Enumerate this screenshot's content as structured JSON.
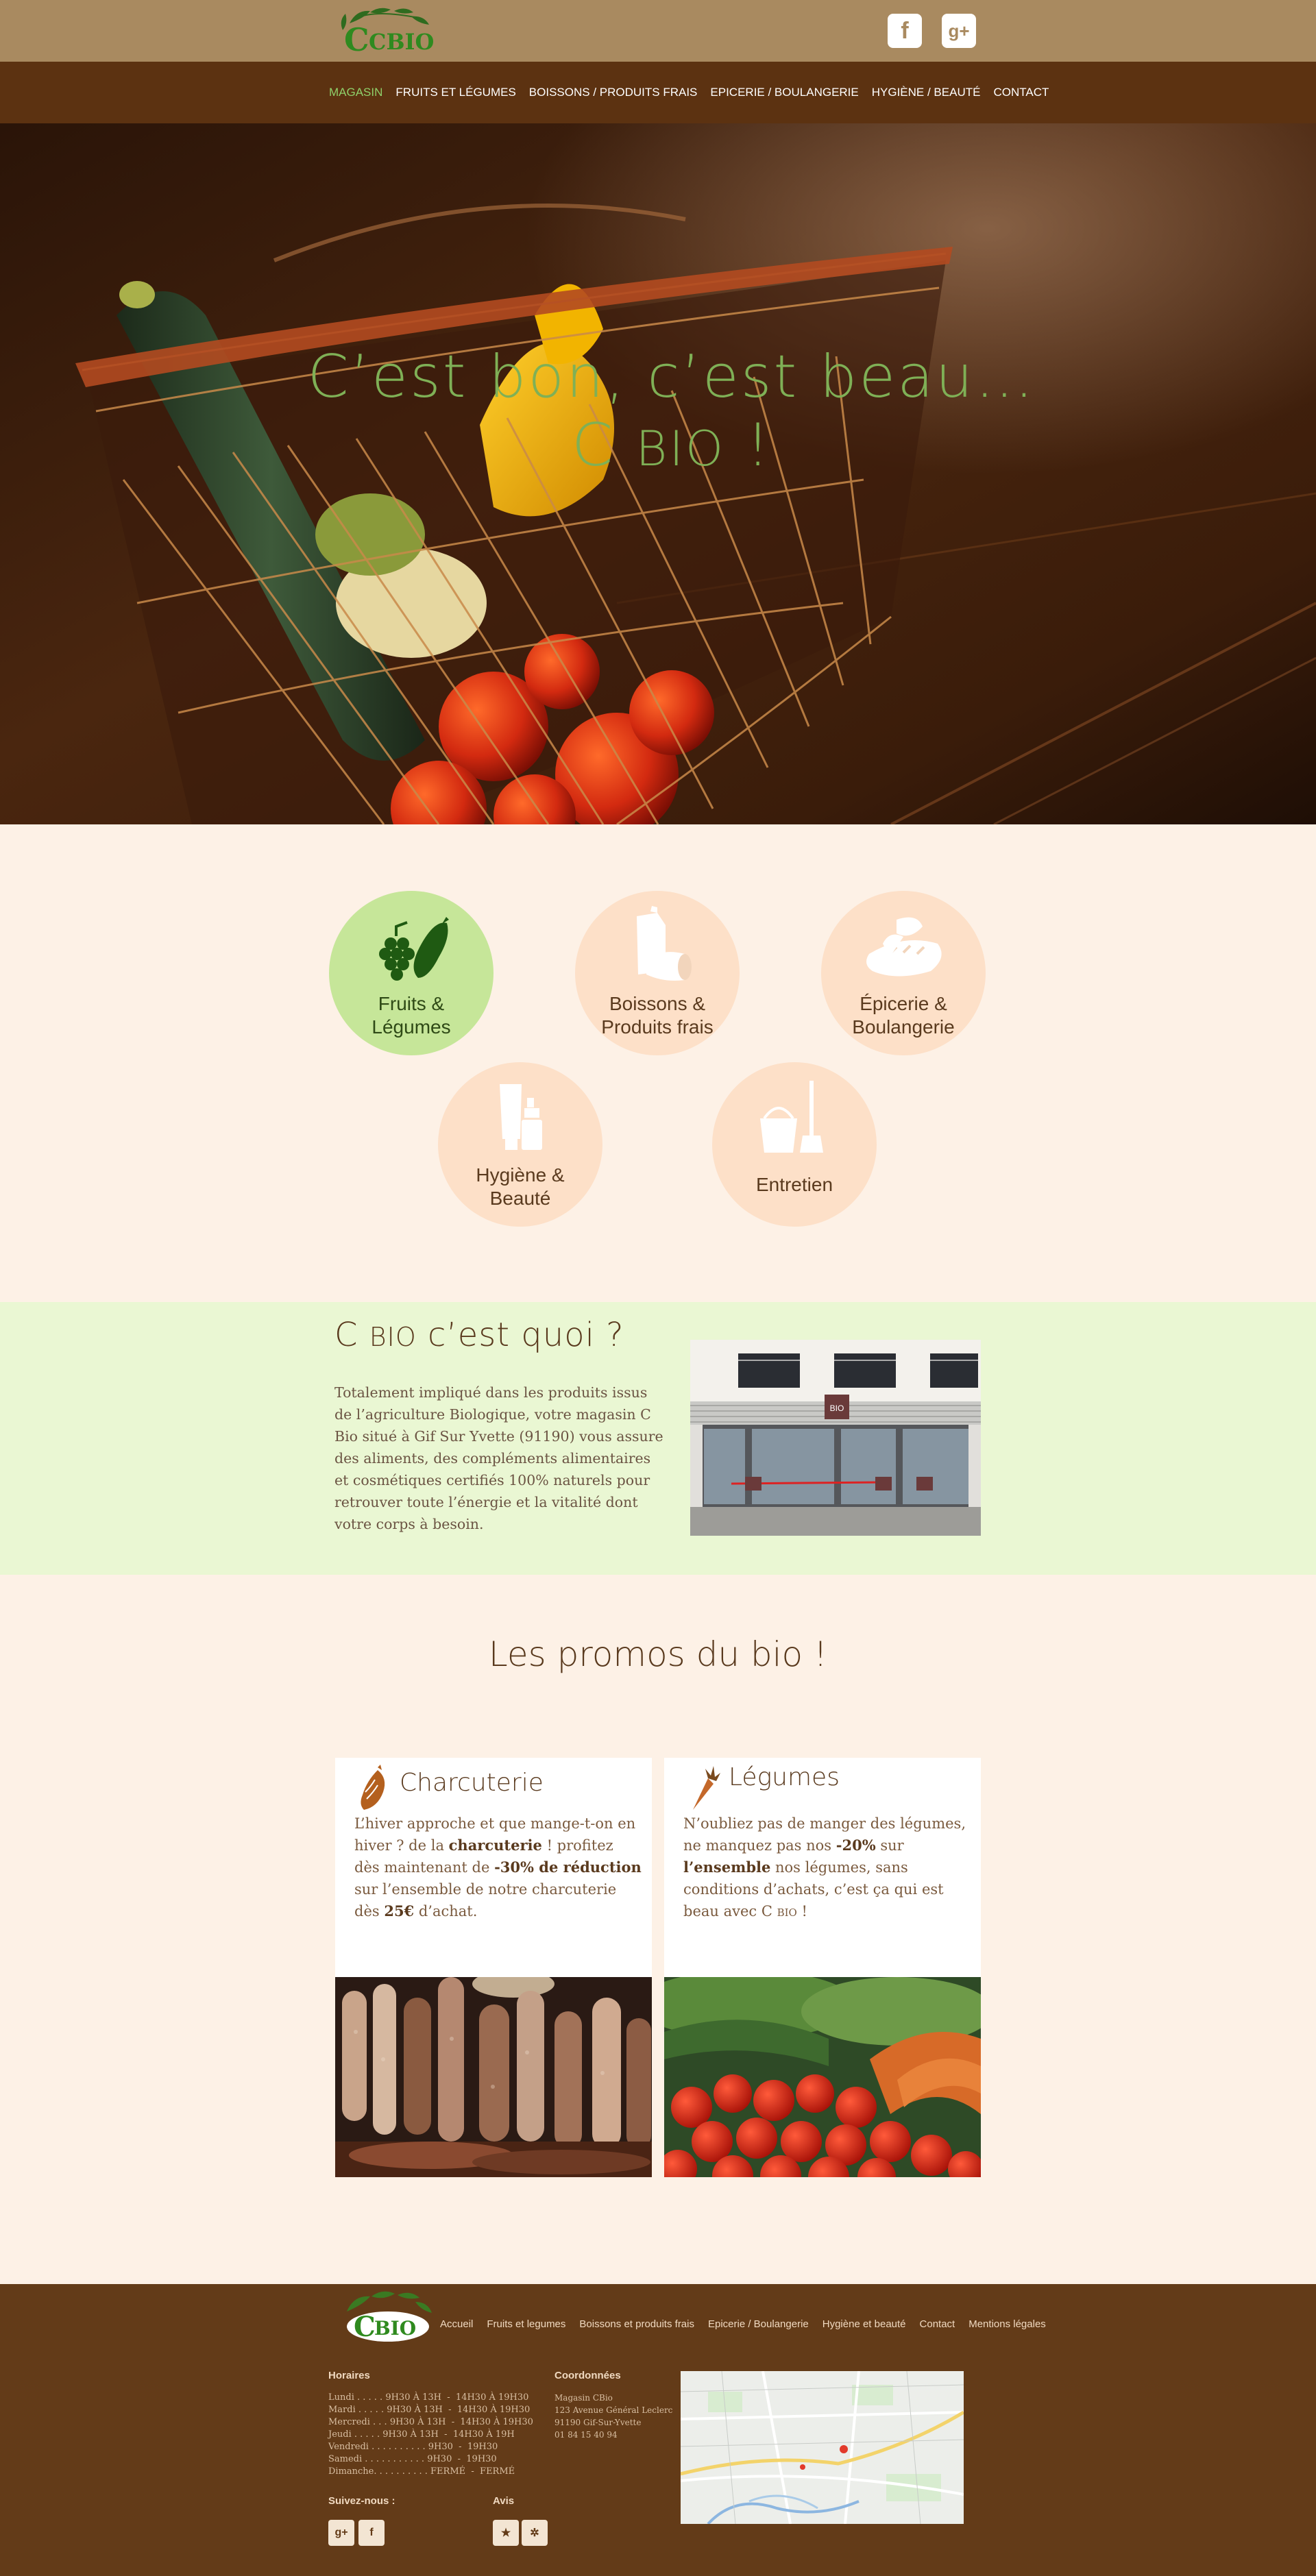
{
  "brand": {
    "logo_text": "CBIO"
  },
  "header": {
    "social": [
      {
        "icon": "facebook-icon",
        "glyph": "f"
      },
      {
        "icon": "google-plus-icon",
        "glyph": "g+"
      }
    ]
  },
  "nav": {
    "items": [
      "MAGASIN",
      "FRUITS ET LÉGUMES",
      "BOISSONS / PRODUITS FRAIS",
      "EPICERIE / BOULANGERIE",
      "HYGIÈNE / BEAUTÉ",
      "CONTACT"
    ],
    "active_index": 0
  },
  "hero": {
    "line1": "C’est bon,  c’est beau…",
    "line2_c": "C",
    "line2_bio": "BIO",
    "line2_end": " !"
  },
  "categories": [
    {
      "line1": "Fruits &",
      "line2": "Légumes",
      "icon": "fruits-vegetables-icon"
    },
    {
      "line1": "Boissons &",
      "line2": "Produits frais",
      "icon": "drinks-icon"
    },
    {
      "line1": "Épicerie &",
      "line2": "Boulangerie",
      "icon": "bread-icon"
    },
    {
      "line1": "Hygiène &",
      "line2": "Beauté",
      "icon": "hygiene-icon"
    },
    {
      "line1": "Entretien",
      "line2": "",
      "icon": "cleaning-bucket-icon"
    }
  ],
  "about": {
    "title_c": "C",
    "title_bio": "BIO",
    "title_rest": " c’est quoi ?",
    "text": "Totalement impliqué dans les produits issus de l’agriculture Biologique, votre magasin C Bio situé à Gif Sur Yvette (91190) vous assure des aliments, des compléments alimentaires et cosmétiques certifiés 100% naturels pour retrouver toute l’énergie et la vitalité dont votre corps à besoin.",
    "store_sign": "BIO"
  },
  "promos": {
    "title": "Les promos du bio !",
    "cards": [
      {
        "title": "Charcuterie",
        "icon": "sausage-icon",
        "t1": "L’hiver approche et que mange-t-on en hiver ? de la ",
        "b1": "charcuterie",
        "t2": " ! profitez dès maintenant de ",
        "b2": "-30% de réduction",
        "t3": " sur l’ensemble de notre charcuterie  dès ",
        "b3": "25€",
        "t4": " d’achat."
      },
      {
        "title": "Légumes",
        "icon": "carrot-icon",
        "t1": "N’oubliez pas de manger des légumes, ne manquez pas nos ",
        "b1": "-20%",
        "t2": " sur ",
        "b2": "l’ensemble",
        "t3": " nos légumes, sans conditions d’achats, c’est ça qui est beau avec C ",
        "b3": "BIO",
        "t4": " !"
      }
    ]
  },
  "footer": {
    "nav": [
      "Accueil",
      "Fruits et legumes",
      "Boissons et produits frais",
      "Epicerie / Boulangerie",
      "Hygiène et beauté",
      "Contact",
      "Mentions légales"
    ],
    "hours_title": "Horaires",
    "hours": [
      "Lundi . . . . . 9H30 À 13H  -  14H30 À 19H30",
      "Mardi . . . . . 9H30 À 13H  -  14H30 À 19H30",
      "Mercredi . . . 9H30 À 13H  -  14H30 À 19H30",
      "Jeudi . . . . . 9H30 À 13H  -  14H30 À 19H",
      "Vendredi . . . . . . . . . . 9H30  -  19H30",
      "Samedi . . . . . . . . . . . 9H30  -  19H30",
      "Dimanche. . . . . . . . . . FERMÉ  -  FERMÉ"
    ],
    "coords_title": "Coordonnées",
    "coords": [
      "Magasin CBio",
      "123 Avenue Général Leclerc",
      "91190 Gif-Sur-Yvette",
      "01 84 15 40 94"
    ],
    "follow_title": "Suivez-nous :",
    "reviews_title": "Avis",
    "follow_icons": [
      {
        "icon": "google-plus-icon",
        "glyph": "g+"
      },
      {
        "icon": "facebook-icon",
        "glyph": "f"
      }
    ],
    "review_icons": [
      {
        "icon": "star-review-icon",
        "glyph": "★"
      },
      {
        "icon": "yelp-icon",
        "glyph": "✲"
      }
    ]
  },
  "colors": {
    "topbar": "#a98a60",
    "nav": "#5c3211",
    "nav_active": "#8fd06a",
    "hero_text": "#7fb056",
    "page_bg": "#fdf1e6",
    "category_circle": "#fde0c8",
    "category_active": "#c6e699",
    "about_bg": "#eaf7d3",
    "footer_bg": "#633b18"
  }
}
